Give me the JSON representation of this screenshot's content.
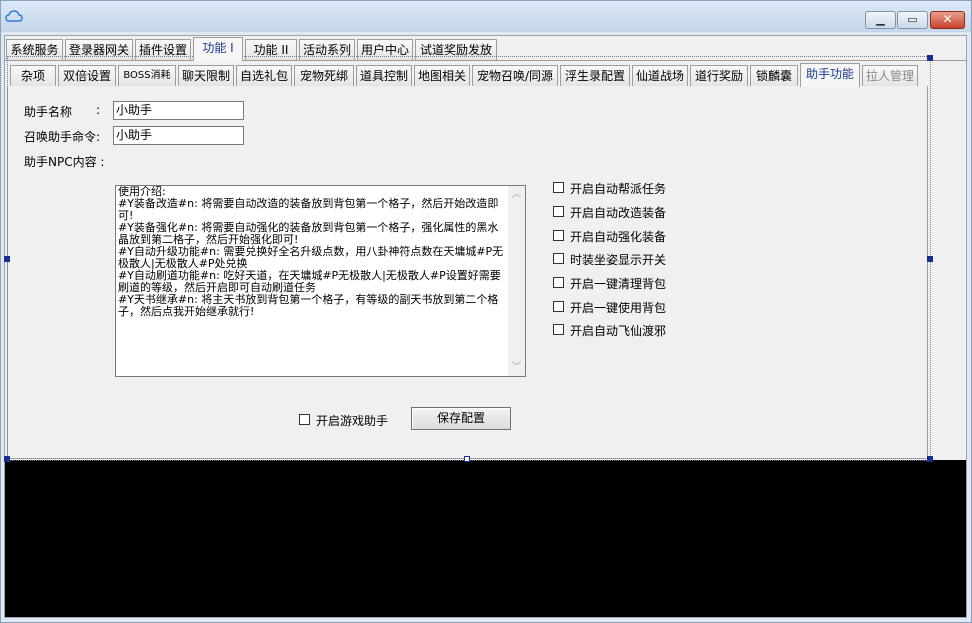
{
  "tabs_top": [
    {
      "label": "系统服务"
    },
    {
      "label": "登录器网关"
    },
    {
      "label": "插件设置"
    },
    {
      "label": "功能 I"
    },
    {
      "label": "功能 II"
    },
    {
      "label": "活动系列"
    },
    {
      "label": "用户中心"
    },
    {
      "label": "试道奖励发放"
    }
  ],
  "tabs_sub": [
    {
      "label": "杂项"
    },
    {
      "label": "双倍设置"
    },
    {
      "label": "BOSS消耗"
    },
    {
      "label": "聊天限制"
    },
    {
      "label": "自选礼包"
    },
    {
      "label": "宠物死绑"
    },
    {
      "label": "道具控制"
    },
    {
      "label": "地图相关"
    },
    {
      "label": "宠物召唤/同源"
    },
    {
      "label": "浮生录配置"
    },
    {
      "label": "仙道战场"
    },
    {
      "label": "道行奖励"
    },
    {
      "label": "锁麟囊"
    },
    {
      "label": "助手功能"
    },
    {
      "label": "拉人管理"
    }
  ],
  "form": {
    "assistant_name_label": "助手名称",
    "assistant_name_colon": ":",
    "assistant_name_value": "小助手",
    "summon_cmd_label": "召唤助手命令:",
    "summon_cmd_value": "小助手",
    "npc_content_label": "助手NPC内容 :",
    "npc_content_value": "使用介绍:\n#Y装备改造#n: 将需要自动改造的装备放到背包第一个格子，然后开始改造即可!\n#Y装备强化#n: 将需要自动强化的装备放到背包第一个格子，强化属性的黑水晶放到第二格子，然后开始强化即可!\n#Y自动升级功能#n: 需要兑换好全名升级点数，用八卦神符点数在天墉城#P无极散人|无极散人#P处兑换\n#Y自动刷道功能#n: 吃好天道，在天墉城#P无极散人|无极散人#P设置好需要刷道的等级，然后开启即可自动刷道任务\n#Y天书继承#n: 将主天书放到背包第一个格子，有等级的副天书放到第二个格子，然后点我开始继承就行!"
  },
  "options": [
    {
      "label": "开启自动帮派任务",
      "checked": false
    },
    {
      "label": "开启自动改造装备",
      "checked": false
    },
    {
      "label": "开启自动强化装备",
      "checked": false
    },
    {
      "label": "时装坐姿显示开关",
      "checked": false
    },
    {
      "label": "开启一键清理背包",
      "checked": false
    },
    {
      "label": "开启一键使用背包",
      "checked": false
    },
    {
      "label": "开启自动飞仙渡邪",
      "checked": false
    }
  ],
  "enable_assistant_label": "开启游戏助手",
  "save_button_label": "保存配置",
  "colors": {
    "active_tab_text": "#1b3b8f",
    "disabled_tab_text": "#8a8a8a",
    "console_bg": "#000000",
    "close_button": "#c7412b"
  }
}
